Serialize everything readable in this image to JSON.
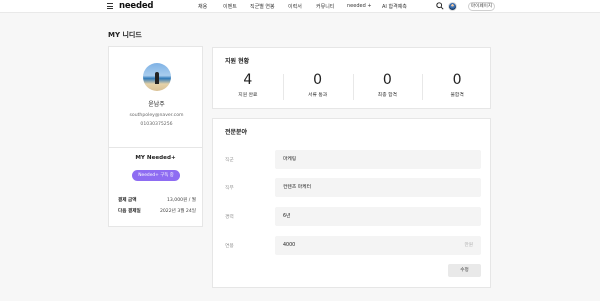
{
  "header": {
    "logo": "needed",
    "nav": [
      "채용",
      "이벤트",
      "직군별 연봉",
      "이력서",
      "커뮤니티",
      "needed +",
      "AI 합격예측"
    ],
    "mypage_label": "마이페이지"
  },
  "page_title": "MY 니디드",
  "profile": {
    "name": "윤남주",
    "email": "southpoley@naver.com",
    "phone": "01030375256",
    "plus_title": "MY Needed+",
    "plus_button": "Needed+ 구독 중",
    "payment_amount_label": "결제 금액",
    "payment_amount_value": "13,000원 / 월",
    "next_payment_label": "다음 결제일",
    "next_payment_value": "2022년 3월 24일"
  },
  "status": {
    "title": "지원 현황",
    "items": [
      {
        "count": "4",
        "label": "지원 완료"
      },
      {
        "count": "0",
        "label": "서류 통과"
      },
      {
        "count": "0",
        "label": "최종 합격"
      },
      {
        "count": "0",
        "label": "불합격"
      }
    ]
  },
  "expertise": {
    "title": "전문분야",
    "fields": [
      {
        "label": "직군",
        "value": "마케팅",
        "unit": ""
      },
      {
        "label": "직무",
        "value": "컨텐츠 마케터",
        "unit": ""
      },
      {
        "label": "경력",
        "value": "6년",
        "unit": ""
      },
      {
        "label": "연봉",
        "value": "4000",
        "unit": "만원"
      }
    ],
    "edit_button": "수정"
  },
  "icons": {
    "menu": "hamburger-menu-icon",
    "search": "search-icon"
  },
  "colors": {
    "accent": "#8e6cf2"
  }
}
